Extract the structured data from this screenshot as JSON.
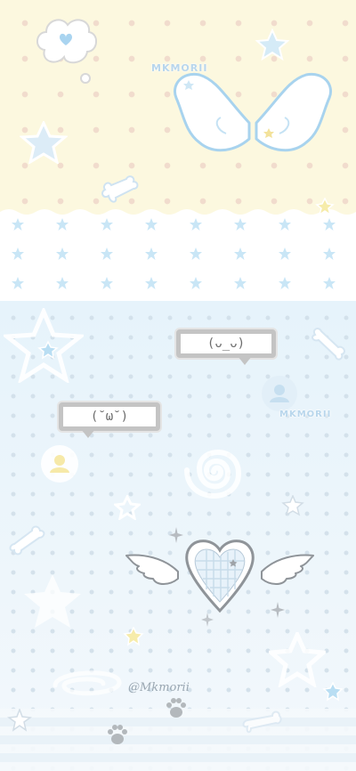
{
  "wallpaper": {
    "watermark_top": "MKMORII",
    "watermark_mid": "MKMORII",
    "signature": "@Mkmorii",
    "kaomoji_right": "(ᴗ_ᴗ)",
    "kaomoji_left": "(˘ω˘)"
  },
  "colors": {
    "top_bg": "#fcf8df",
    "polka_dot": "#f1dccd",
    "bottom_bg": "#e6f3fb",
    "star_blue": "#b9def3",
    "star_yellow": "#f6ecaa",
    "bubble_border": "#c4c4c4",
    "wing_outline": "#a8d3ee"
  },
  "icons": [
    "thought-cloud-icon",
    "heart-icon",
    "wings-icon",
    "star-icon",
    "bone-icon",
    "paw-icon",
    "heart-with-wings-icon",
    "user-icon",
    "swirl-icon",
    "sparkle-icon"
  ]
}
